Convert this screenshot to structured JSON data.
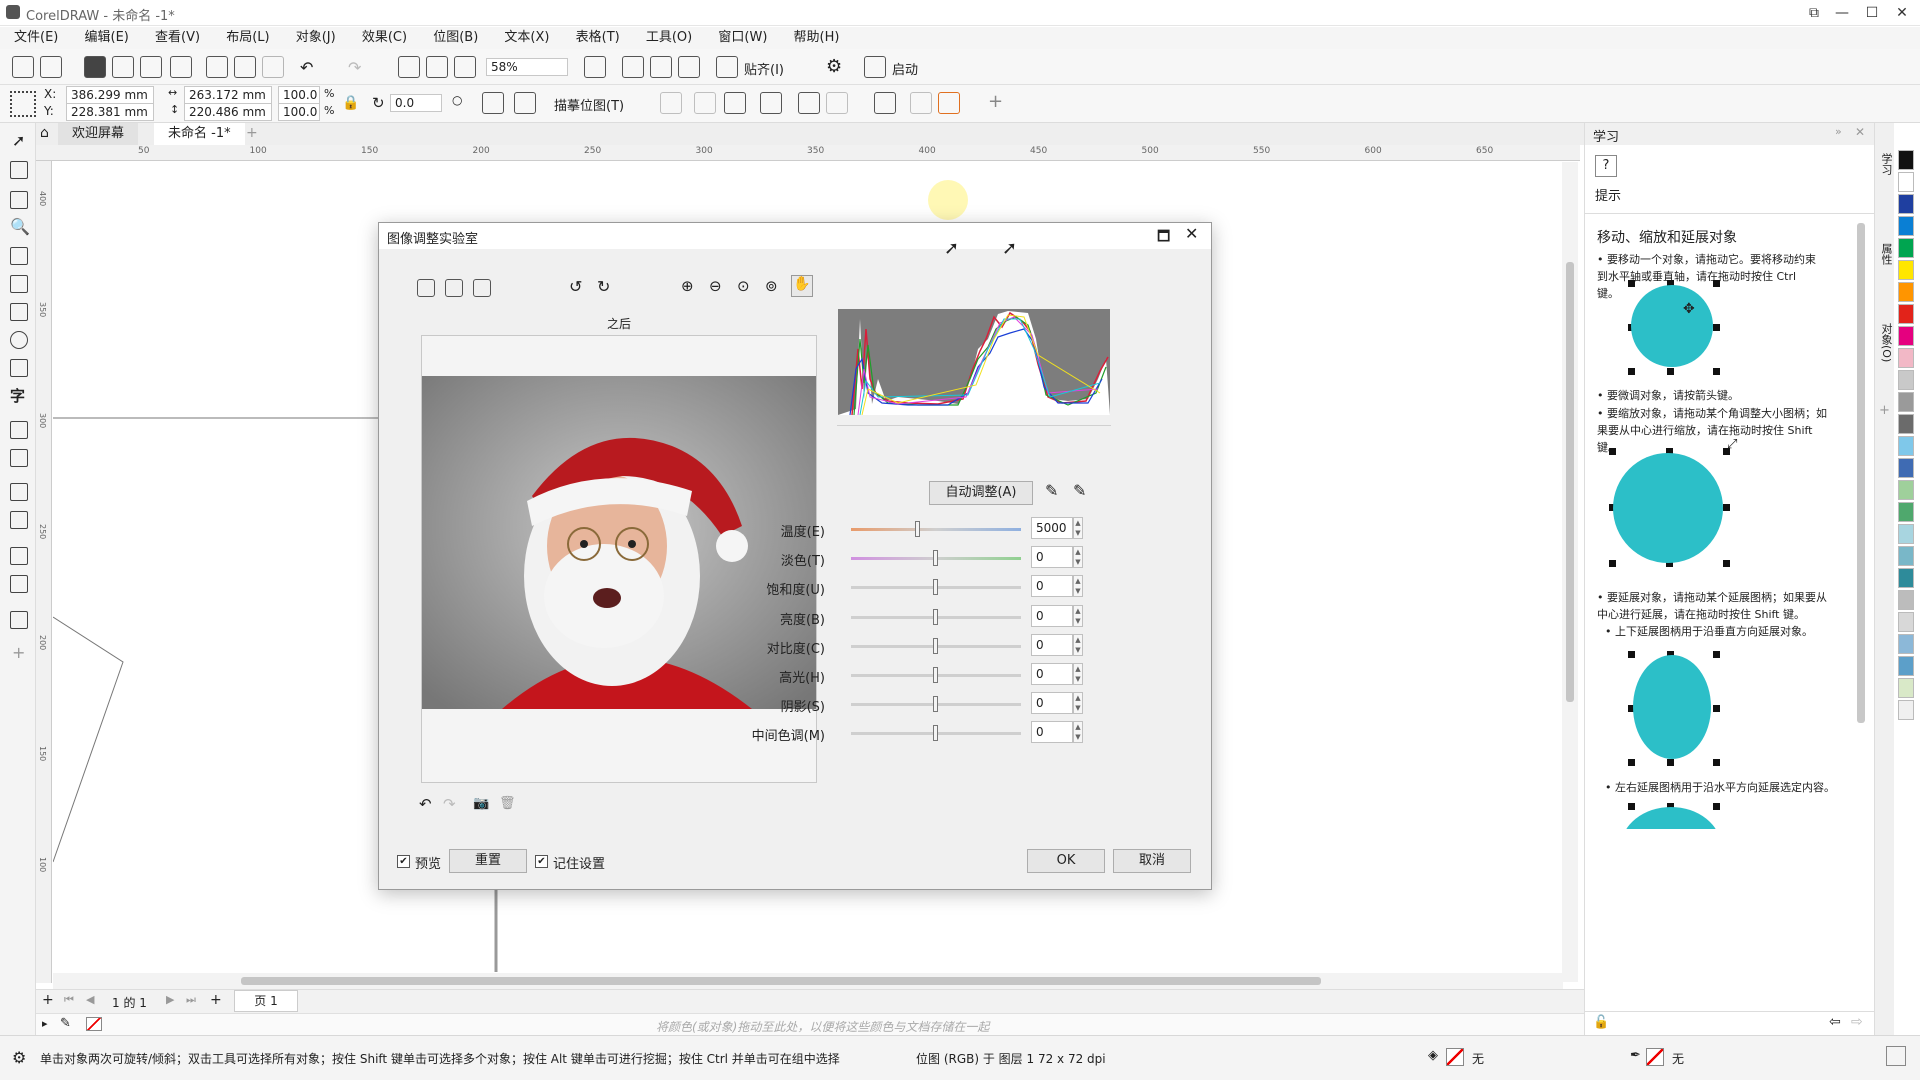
{
  "app": {
    "title": "CorelDRAW - 未命名 -1*"
  },
  "menu": [
    "文件(E)",
    "编辑(E)",
    "查看(V)",
    "布局(L)",
    "对象(J)",
    "效果(C)",
    "位图(B)",
    "文本(X)",
    "表格(T)",
    "工具(O)",
    "窗口(W)",
    "帮助(H)"
  ],
  "toolbar": {
    "zoom": "58%",
    "snap_label": "贴齐(I)",
    "launch_label": "启动"
  },
  "props": {
    "x_label": "X:",
    "x": "386.299 mm",
    "y_label": "Y:",
    "y": "228.381 mm",
    "width": "263.172 mm",
    "height": "220.486 mm",
    "scale_w": "100.0",
    "scale_h": "100.0",
    "pct": "%",
    "rotation": "0.0",
    "trace_label": "描摹位图(T)"
  },
  "tabs": {
    "welcome": "欢迎屏幕",
    "doc": "未命名 -1*"
  },
  "ruler_h": [
    "50",
    "100",
    "150",
    "200",
    "250",
    "300",
    "350",
    "400",
    "450",
    "500",
    "550",
    "600",
    "650"
  ],
  "ruler_v": [
    "400",
    "350",
    "300",
    "250",
    "200",
    "150",
    "100"
  ],
  "dialog": {
    "title": "图像调整实验室",
    "preview_label": "之后",
    "auto_adjust": "自动调整(A)",
    "sliders": [
      {
        "label": "温度(E)",
        "value": "5000"
      },
      {
        "label": "淡色(T)",
        "value": "0"
      },
      {
        "label": "饱和度(U)",
        "value": "0"
      },
      {
        "label": "亮度(B)",
        "value": "0"
      },
      {
        "label": "对比度(C)",
        "value": "0"
      },
      {
        "label": "高光(H)",
        "value": "0"
      },
      {
        "label": "阴影(S)",
        "value": "0"
      },
      {
        "label": "中间色调(M)",
        "value": "0"
      }
    ],
    "preview_check": "预览",
    "reset": "重置",
    "remember_check": "记住设置",
    "ok": "OK",
    "cancel": "取消"
  },
  "dock": {
    "title": "学习",
    "hints_label": "提示",
    "heading": "移动、缩放和延展对象",
    "tip1": "要移动一个对象，请拖动它。要将移动约束到水平轴或垂直轴，请在拖动时按住 Ctrl 键。",
    "tip2": "要微调对象，请按箭头键。",
    "tip3": "要缩放对象，请拖动某个角调整大小图柄；如果要从中心进行缩放，请在拖动时按住 Shift 键。",
    "tip4": "要延展对象，请拖动某个延展图柄；如果要从中心进行延展，请在拖动时按住 Shift 键。",
    "tip5": "上下延展图柄用于沿垂直方向延展对象。",
    "tip6": "左右延展图柄用于沿水平方向延展选定内容。"
  },
  "strip": {
    "learn": "学习",
    "props": "属性",
    "objects": "对象(O)"
  },
  "pagebar": {
    "page_count": "1 的 1",
    "page_tab": "页 1"
  },
  "colorbar": {
    "hint": "将颜色(或对象)拖动至此处，以便将这些颜色与文档存储在一起"
  },
  "status": {
    "text": "单击对象两次可旋转/倾斜；双击工具可选择所有对象；按住 Shift 键单击可选择多个对象；按住 Alt 键单击可进行挖掘；按住 Ctrl 并单击可在组中选择",
    "info": "位图 (RGB) 于 图层 1 72 x 72 dpi",
    "fill_none": "无",
    "outline_none": "无"
  },
  "colors": {
    "accent": "#2cbfc8"
  },
  "palette": [
    "#111111",
    "#ffffff",
    "#1f3fa0",
    "#0a7fd4",
    "#00a550",
    "#ffe600",
    "#ff9500",
    "#e2231a",
    "#e5007f",
    "#f2b8c6",
    "#c9c9c9",
    "#9a9a9a",
    "#6b6b6b",
    "#7fc8ea",
    "#3f6bb3",
    "#9fd09b",
    "#4fa86d",
    "#a8d5e0",
    "#79b7c8",
    "#2e8b9a",
    "#bcbcbc",
    "#d8d8d8",
    "#8cb8d8",
    "#5c9fc9",
    "#d9e9c8",
    "#f0f0f0"
  ]
}
